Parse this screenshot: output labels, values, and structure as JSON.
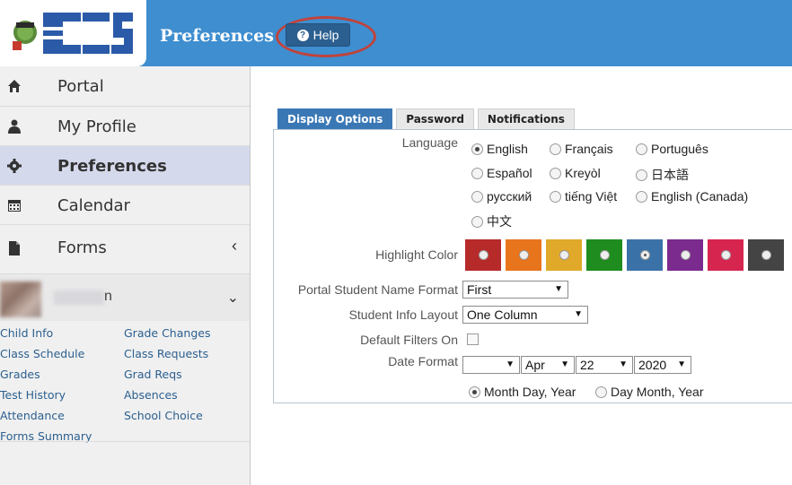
{
  "header": {
    "title": "Preferences",
    "help_label": "Help",
    "accent": "#3e8ed0"
  },
  "sidebar": {
    "items": [
      {
        "label": "Portal",
        "icon": "home-icon"
      },
      {
        "label": "My Profile",
        "icon": "user-icon"
      },
      {
        "label": "Preferences",
        "icon": "gear-icon",
        "active": true
      },
      {
        "label": "Calendar",
        "icon": "calendar-icon"
      },
      {
        "label": "Forms",
        "icon": "file-icon"
      }
    ],
    "user": {
      "name_suffix": "n"
    },
    "links_left": [
      "Child Info",
      "Class Schedule",
      "Grades",
      "Test History",
      "Attendance",
      "Forms Summary"
    ],
    "links_right": [
      "Grade Changes",
      "Class Requests",
      "Grad Reqs",
      "Absences",
      "School Choice"
    ]
  },
  "tabs": [
    "Display Options",
    "Password",
    "Notifications"
  ],
  "form": {
    "language_label": "Language",
    "languages": [
      "English",
      "Français",
      "Português",
      "Español",
      "Kreyòl",
      "日本語",
      "русский",
      "tiếng Việt",
      "English (Canada)",
      "中文"
    ],
    "selected_language": "English",
    "highlight_label": "Highlight Color",
    "highlight_colors": [
      "#b72a2a",
      "#e8741c",
      "#e0a92a",
      "#1e8c1e",
      "#3a72a8",
      "#7b2a8d",
      "#d6264f",
      "#444444"
    ],
    "highlight_selected": "#3a72a8",
    "name_format_label": "Portal Student Name Format",
    "name_format_value": "First",
    "layout_label": "Student Info Layout",
    "layout_value": "One Column",
    "filters_label": "Default Filters On",
    "date_label": "Date Format",
    "date_month": "Apr",
    "date_day": "22",
    "date_year": "2020",
    "date_order_options": [
      "Month Day, Year",
      "Day Month, Year"
    ],
    "date_order_selected": "Month Day, Year"
  }
}
